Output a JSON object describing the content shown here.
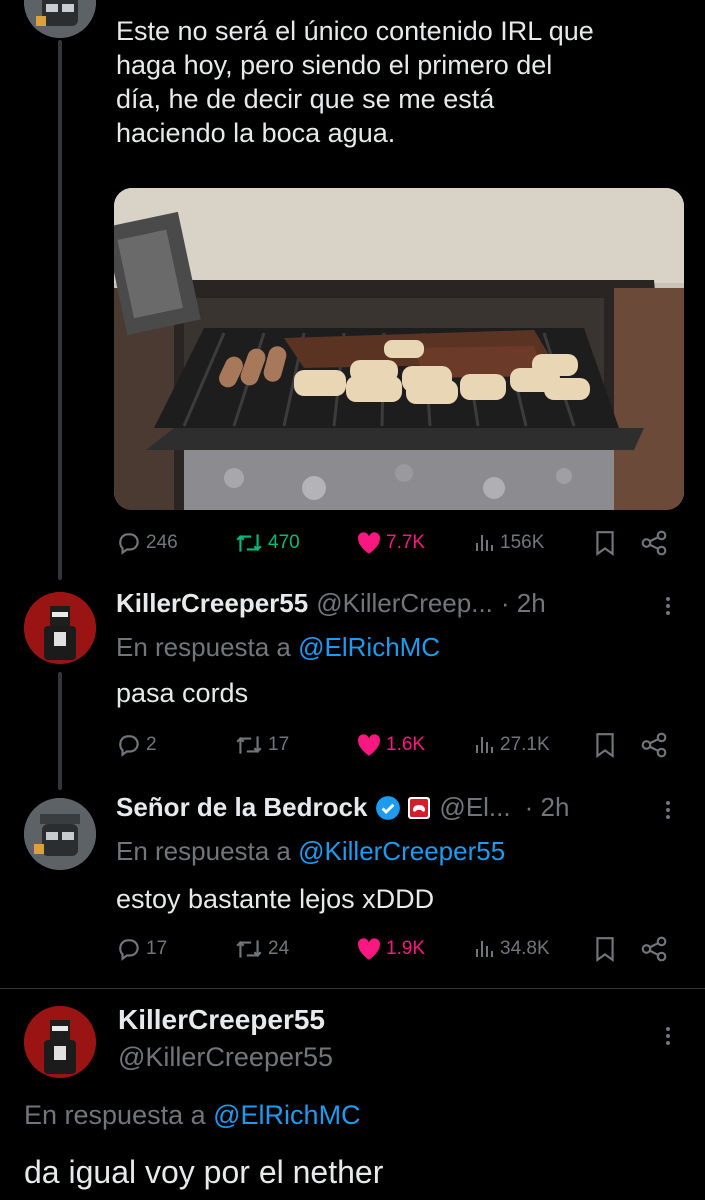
{
  "tweet1": {
    "text_lines": [
      "Este no será el único contenido IRL que",
      "haga hoy, pero siendo el primero del",
      "día, he de decir que se me está",
      "haciendo la boca agua."
    ],
    "actions": {
      "replies": "246",
      "retweets": "470",
      "likes": "7.7K",
      "views": "156K"
    }
  },
  "tweet2": {
    "name": "KillerCreeper55",
    "handle": "@KillerCreep...",
    "time": "· 2h",
    "reply_prefix": "En respuesta a",
    "reply_to": "@ElRichMC",
    "text": "pasa cords",
    "actions": {
      "replies": "2",
      "retweets": "17",
      "likes": "1.6K",
      "views": "27.1K"
    }
  },
  "tweet3": {
    "name": "Señor de la Bedrock",
    "handle": "@El...",
    "time": "· 2h",
    "reply_prefix": "En respuesta a",
    "reply_to": "@KillerCreeper55",
    "text": "estoy bastante lejos xDDD",
    "actions": {
      "replies": "17",
      "retweets": "24",
      "likes": "1.9K",
      "views": "34.8K"
    }
  },
  "tweet4": {
    "name": "KillerCreeper55",
    "handle": "@KillerCreeper55",
    "reply_prefix": "En respuesta a",
    "reply_to": "@ElRichMC",
    "text": "da igual voy por el nether"
  },
  "colors": {
    "background": "#000000",
    "text": "#e7e9ea",
    "muted": "#71767b",
    "link": "#1d9bf0",
    "retweet": "#00ba7c",
    "like": "#f91880",
    "verified": "#1d9bf0"
  },
  "icons": [
    "reply-icon",
    "retweet-icon",
    "like-icon",
    "views-icon",
    "bookmark-icon",
    "share-icon",
    "verified-icon",
    "gamepad-badge-icon",
    "more-icon"
  ]
}
